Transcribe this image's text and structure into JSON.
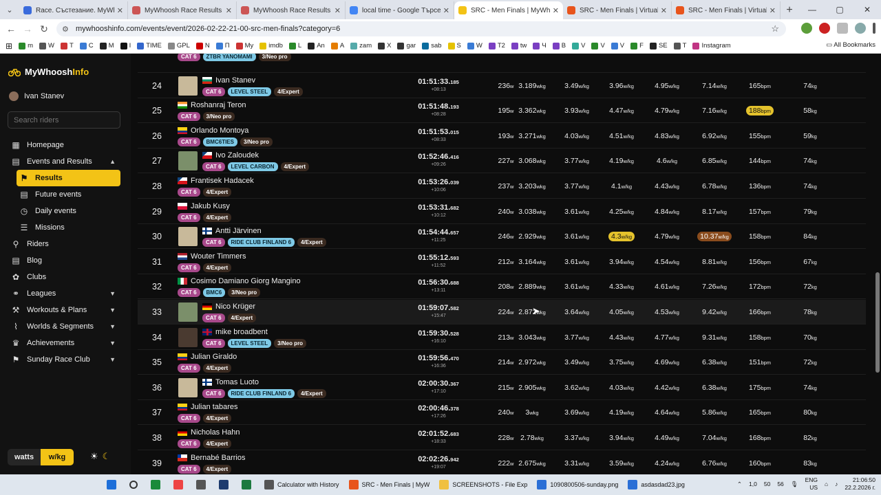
{
  "browser": {
    "tabs": [
      {
        "title": "Race. Състезание. MyWhoosh",
        "color": "#3a6bdc"
      },
      {
        "title": "MyWhoosh Race Results",
        "color": "#c55"
      },
      {
        "title": "MyWhoosh Race Results",
        "color": "#c55"
      },
      {
        "title": "local time - Google Търсене",
        "color": "#4285f4"
      },
      {
        "title": "SRC - Men Finals | MyWhoosh",
        "color": "#f3c316"
      },
      {
        "title": "SRC - Men Finals | Virtual Ride",
        "color": "#e8541c"
      },
      {
        "title": "SRC - Men Finals | Virtual Ride",
        "color": "#e8541c"
      }
    ],
    "url": "mywhooshinfo.com/events/event/2026-02-22-21-00-src-men-finals?category=6",
    "bookmarks": [
      "m",
      "W",
      "T",
      "C",
      "M",
      "I",
      "TIME",
      "GPL",
      "N",
      "П",
      "My",
      "imdb",
      "L",
      "An",
      "A",
      "zam",
      "X",
      "gar",
      "sab",
      "S",
      "W",
      "T2",
      "tw",
      "Ч",
      "В",
      "V",
      "V",
      "V",
      "F",
      "SE",
      "T",
      "Instagram"
    ],
    "all_bookmarks": "All Bookmarks"
  },
  "sidebar": {
    "logo_main": "MyWhoosh",
    "logo_accent": "Info",
    "user": "Ivan Stanev",
    "search_placeholder": "Search riders",
    "nav": [
      {
        "label": "Homepage",
        "icon": "homepage-icon",
        "glyph": "▦"
      },
      {
        "label": "Events and Results",
        "icon": "calendar-icon",
        "glyph": "▤",
        "expanded": true
      },
      {
        "label": "Results",
        "icon": "flag-icon",
        "glyph": "⚑",
        "sub": true,
        "selected": true
      },
      {
        "label": "Future events",
        "icon": "calendar-icon",
        "glyph": "▤",
        "sub": true
      },
      {
        "label": "Daily events",
        "icon": "clock-icon",
        "glyph": "◷",
        "sub": true
      },
      {
        "label": "Missions",
        "icon": "list-icon",
        "glyph": "☰",
        "sub": true
      },
      {
        "label": "Riders",
        "icon": "bike-icon",
        "glyph": "⚲"
      },
      {
        "label": "Blog",
        "icon": "blog-icon",
        "glyph": "▤"
      },
      {
        "label": "Clubs",
        "icon": "clubs-icon",
        "glyph": "✿"
      },
      {
        "label": "Leagues",
        "icon": "leagues-icon",
        "glyph": "⚭",
        "chevron": true
      },
      {
        "label": "Workouts & Plans",
        "icon": "workouts-icon",
        "glyph": "⚒",
        "chevron": true
      },
      {
        "label": "Worlds & Segments",
        "icon": "worlds-icon",
        "glyph": "⌇",
        "chevron": true
      },
      {
        "label": "Achievements",
        "icon": "trophy-icon",
        "glyph": "♛",
        "chevron": true
      },
      {
        "label": "Sunday Race Club",
        "icon": "src-icon",
        "glyph": "⚑",
        "chevron": true
      }
    ],
    "units": {
      "watts": "watts",
      "wkg": "w/kg"
    }
  },
  "results": [
    {
      "rank": "",
      "name": "",
      "flag": "",
      "thumb": false,
      "badges": [
        {
          "t": "CAT 6",
          "k": "cat"
        },
        {
          "t": "ZTBR YANOMAMI",
          "k": "team"
        },
        {
          "t": "3/Neo pro",
          "k": "lvl"
        }
      ],
      "time": "",
      "ms": "",
      "gap": "+08:13",
      "watts": "",
      "wkg": "",
      "w1": "",
      "w2": "",
      "w3": "",
      "w4": "",
      "hr": "",
      "weight": ""
    },
    {
      "rank": "24",
      "name": "Ivan Stanev",
      "flag": "bg",
      "thumb": true,
      "badges": [
        {
          "t": "CAT 6",
          "k": "cat"
        },
        {
          "t": "LEVEL STEEL",
          "k": "team"
        },
        {
          "t": "4/Expert",
          "k": "lvl"
        }
      ],
      "time": "01:51:33.",
      "ms": "185",
      "gap": "+08:13",
      "watts": "236",
      "wkg": "3.189",
      "w1": "3.49",
      "w2": "3.96",
      "w3": "4.95",
      "w4": "7.14",
      "hr": "165",
      "weight": "74"
    },
    {
      "rank": "25",
      "name": "Roshanraj Teron",
      "flag": "in",
      "thumb": false,
      "badges": [
        {
          "t": "CAT 6",
          "k": "cat"
        },
        {
          "t": "3/Neo pro",
          "k": "lvl"
        }
      ],
      "time": "01:51:48.",
      "ms": "193",
      "gap": "+08:28",
      "watts": "195",
      "wkg": "3.362",
      "w1": "3.93",
      "w2": "4.47",
      "w3": "4.79",
      "w4": "7.16",
      "hr": "188",
      "hrhl": "y",
      "weight": "58"
    },
    {
      "rank": "26",
      "name": "Orlando Montoya",
      "flag": "co",
      "thumb": false,
      "badges": [
        {
          "t": "CAT 6",
          "k": "cat"
        },
        {
          "t": "BMC6TIES",
          "k": "team"
        },
        {
          "t": "3/Neo pro",
          "k": "lvl"
        }
      ],
      "time": "01:51:53.",
      "ms": "015",
      "gap": "+08:33",
      "watts": "193",
      "wkg": "3.271",
      "w1": "4.03",
      "w2": "4.51",
      "w3": "4.83",
      "w4": "6.92",
      "hr": "155",
      "weight": "59"
    },
    {
      "rank": "27",
      "name": "Ivo Zaloudek",
      "flag": "cz",
      "thumb": true,
      "badges": [
        {
          "t": "CAT 6",
          "k": "cat"
        },
        {
          "t": "LEVEL CARBON",
          "k": "team"
        },
        {
          "t": "4/Expert",
          "k": "lvl"
        }
      ],
      "time": "01:52:46.",
      "ms": "416",
      "gap": "+09:26",
      "watts": "227",
      "wkg": "3.068",
      "w1": "3.77",
      "w2": "4.19",
      "w3": "4.6",
      "w4": "6.85",
      "hr": "144",
      "weight": "74"
    },
    {
      "rank": "28",
      "name": "Frantisek Hadacek",
      "flag": "cz",
      "thumb": false,
      "badges": [
        {
          "t": "CAT 6",
          "k": "cat"
        },
        {
          "t": "4/Expert",
          "k": "lvl"
        }
      ],
      "time": "01:53:26.",
      "ms": "039",
      "gap": "+10:06",
      "watts": "237",
      "wkg": "3.203",
      "w1": "3.77",
      "w2": "4.1",
      "w3": "4.43",
      "w4": "6.78",
      "hr": "136",
      "weight": "74"
    },
    {
      "rank": "29",
      "name": "Jakub Kusy",
      "flag": "pl",
      "thumb": false,
      "badges": [
        {
          "t": "CAT 6",
          "k": "cat"
        },
        {
          "t": "4/Expert",
          "k": "lvl"
        }
      ],
      "time": "01:53:31.",
      "ms": "682",
      "gap": "+10:12",
      "watts": "240",
      "wkg": "3.038",
      "w1": "3.61",
      "w2": "4.25",
      "w3": "4.84",
      "w4": "8.17",
      "hr": "157",
      "weight": "79"
    },
    {
      "rank": "30",
      "name": "Antti Järvinen",
      "flag": "fi",
      "thumb": true,
      "badges": [
        {
          "t": "CAT 6",
          "k": "cat"
        },
        {
          "t": "RIDE CLUB FINLAND 6",
          "k": "team"
        },
        {
          "t": "4/Expert",
          "k": "lvl"
        }
      ],
      "time": "01:54:44.",
      "ms": "657",
      "gap": "+11:25",
      "watts": "246",
      "wkg": "2.929",
      "w1": "3.61",
      "w2": "4.3",
      "w2hl": "y",
      "w3": "4.79",
      "w4": "10.37",
      "w4hl": "o",
      "hr": "158",
      "weight": "84"
    },
    {
      "rank": "31",
      "name": "Wouter Timmers",
      "flag": "nl",
      "thumb": false,
      "badges": [
        {
          "t": "CAT 6",
          "k": "cat"
        },
        {
          "t": "4/Expert",
          "k": "lvl"
        }
      ],
      "time": "01:55:12.",
      "ms": "593",
      "gap": "+11:52",
      "watts": "212",
      "wkg": "3.164",
      "w1": "3.61",
      "w2": "3.94",
      "w3": "4.54",
      "w4": "8.81",
      "hr": "156",
      "weight": "67"
    },
    {
      "rank": "32",
      "name": "Cosimo Damiano Giorg Mangino",
      "flag": "it",
      "thumb": false,
      "badges": [
        {
          "t": "CAT 6",
          "k": "cat"
        },
        {
          "t": "BMC6",
          "k": "team"
        },
        {
          "t": "3/Neo pro",
          "k": "lvl"
        }
      ],
      "time": "01:56:30.",
      "ms": "688",
      "gap": "+13:11",
      "watts": "208",
      "wkg": "2.889",
      "w1": "3.61",
      "w2": "4.33",
      "w3": "4.61",
      "w4": "7.26",
      "hr": "172",
      "weight": "72"
    },
    {
      "rank": "33",
      "name": "Nico Krüger",
      "flag": "de",
      "thumb": true,
      "badges": [
        {
          "t": "CAT 6",
          "k": "cat"
        },
        {
          "t": "4/Expert",
          "k": "lvl"
        }
      ],
      "time": "01:59:07.",
      "ms": "582",
      "gap": "+15:47",
      "watts": "224",
      "wkg": "2.872",
      "w1": "3.64",
      "w2": "4.05",
      "w3": "4.53",
      "w4": "9.42",
      "hr": "166",
      "weight": "78",
      "hl": true
    },
    {
      "rank": "34",
      "name": "mike broadbent",
      "flag": "gb",
      "thumb": true,
      "badges": [
        {
          "t": "CAT 6",
          "k": "cat"
        },
        {
          "t": "LEVEL STEEL",
          "k": "team"
        },
        {
          "t": "3/Neo pro",
          "k": "lvl"
        }
      ],
      "time": "01:59:30.",
      "ms": "528",
      "gap": "+16:10",
      "watts": "213",
      "wkg": "3.043",
      "w1": "3.77",
      "w2": "4.43",
      "w3": "4.77",
      "w4": "9.31",
      "hr": "158",
      "weight": "70"
    },
    {
      "rank": "35",
      "name": "Julian Giraldo",
      "flag": "co",
      "thumb": false,
      "badges": [
        {
          "t": "CAT 6",
          "k": "cat"
        },
        {
          "t": "4/Expert",
          "k": "lvl"
        }
      ],
      "time": "01:59:56.",
      "ms": "470",
      "gap": "+16:36",
      "watts": "214",
      "wkg": "2.972",
      "w1": "3.49",
      "w2": "3.75",
      "w3": "4.69",
      "w4": "6.38",
      "hr": "151",
      "weight": "72"
    },
    {
      "rank": "36",
      "name": "Tomas Luoto",
      "flag": "fi",
      "thumb": true,
      "badges": [
        {
          "t": "CAT 6",
          "k": "cat"
        },
        {
          "t": "RIDE CLUB FINLAND 6",
          "k": "team"
        },
        {
          "t": "4/Expert",
          "k": "lvl"
        }
      ],
      "time": "02:00:30.",
      "ms": "367",
      "gap": "+17:10",
      "watts": "215",
      "wkg": "2.905",
      "w1": "3.62",
      "w2": "4.03",
      "w3": "4.42",
      "w4": "6.38",
      "hr": "175",
      "weight": "74"
    },
    {
      "rank": "37",
      "name": "Julian tabares",
      "flag": "co",
      "thumb": false,
      "badges": [
        {
          "t": "CAT 6",
          "k": "cat"
        },
        {
          "t": "4/Expert",
          "k": "lvl"
        }
      ],
      "time": "02:00:46.",
      "ms": "378",
      "gap": "+17:26",
      "watts": "240",
      "wkg": "3",
      "w1": "3.69",
      "w2": "4.19",
      "w3": "4.64",
      "w4": "5.86",
      "hr": "165",
      "weight": "80"
    },
    {
      "rank": "38",
      "name": "Nicholas Hahn",
      "flag": "de",
      "thumb": false,
      "badges": [
        {
          "t": "CAT 6",
          "k": "cat"
        },
        {
          "t": "4/Expert",
          "k": "lvl"
        }
      ],
      "time": "02:01:52.",
      "ms": "683",
      "gap": "+18:33",
      "watts": "228",
      "wkg": "2.78",
      "w1": "3.37",
      "w2": "3.94",
      "w3": "4.49",
      "w4": "7.04",
      "hr": "168",
      "weight": "82"
    },
    {
      "rank": "39",
      "name": "Bernabé Barrios",
      "flag": "cl",
      "thumb": false,
      "badges": [
        {
          "t": "CAT 6",
          "k": "cat"
        },
        {
          "t": "4/Expert",
          "k": "lvl"
        }
      ],
      "time": "02:02:26.",
      "ms": "942",
      "gap": "+19:07",
      "watts": "222",
      "wkg": "2.675",
      "w1": "3.31",
      "w2": "3.59",
      "w3": "4.24",
      "w4": "6.76",
      "hr": "160",
      "weight": "83"
    }
  ],
  "units_text": {
    "w": "w",
    "wkg": "wkg",
    "wslashkg": "w/kg",
    "bpm": "bpm",
    "kg": "kg"
  },
  "taskbar": {
    "apps": [
      {
        "label": "Calculator with History",
        "color": "#555"
      },
      {
        "label": "SRC - Men Finals | MyW",
        "color": "#e8541c"
      },
      {
        "label": "SCREENSHOTS - File Exp",
        "color": "#f0c040"
      },
      {
        "label": "1090800506-sunday.png",
        "color": "#2a6fd6"
      },
      {
        "label": "asdasdad23.jpg",
        "color": "#2a6fd6"
      }
    ],
    "tray_nums": [
      "1,0",
      "50",
      "56"
    ],
    "lang1": "ENG",
    "lang2": "US",
    "time": "21:06:50",
    "date": "22.2.2026 г."
  }
}
